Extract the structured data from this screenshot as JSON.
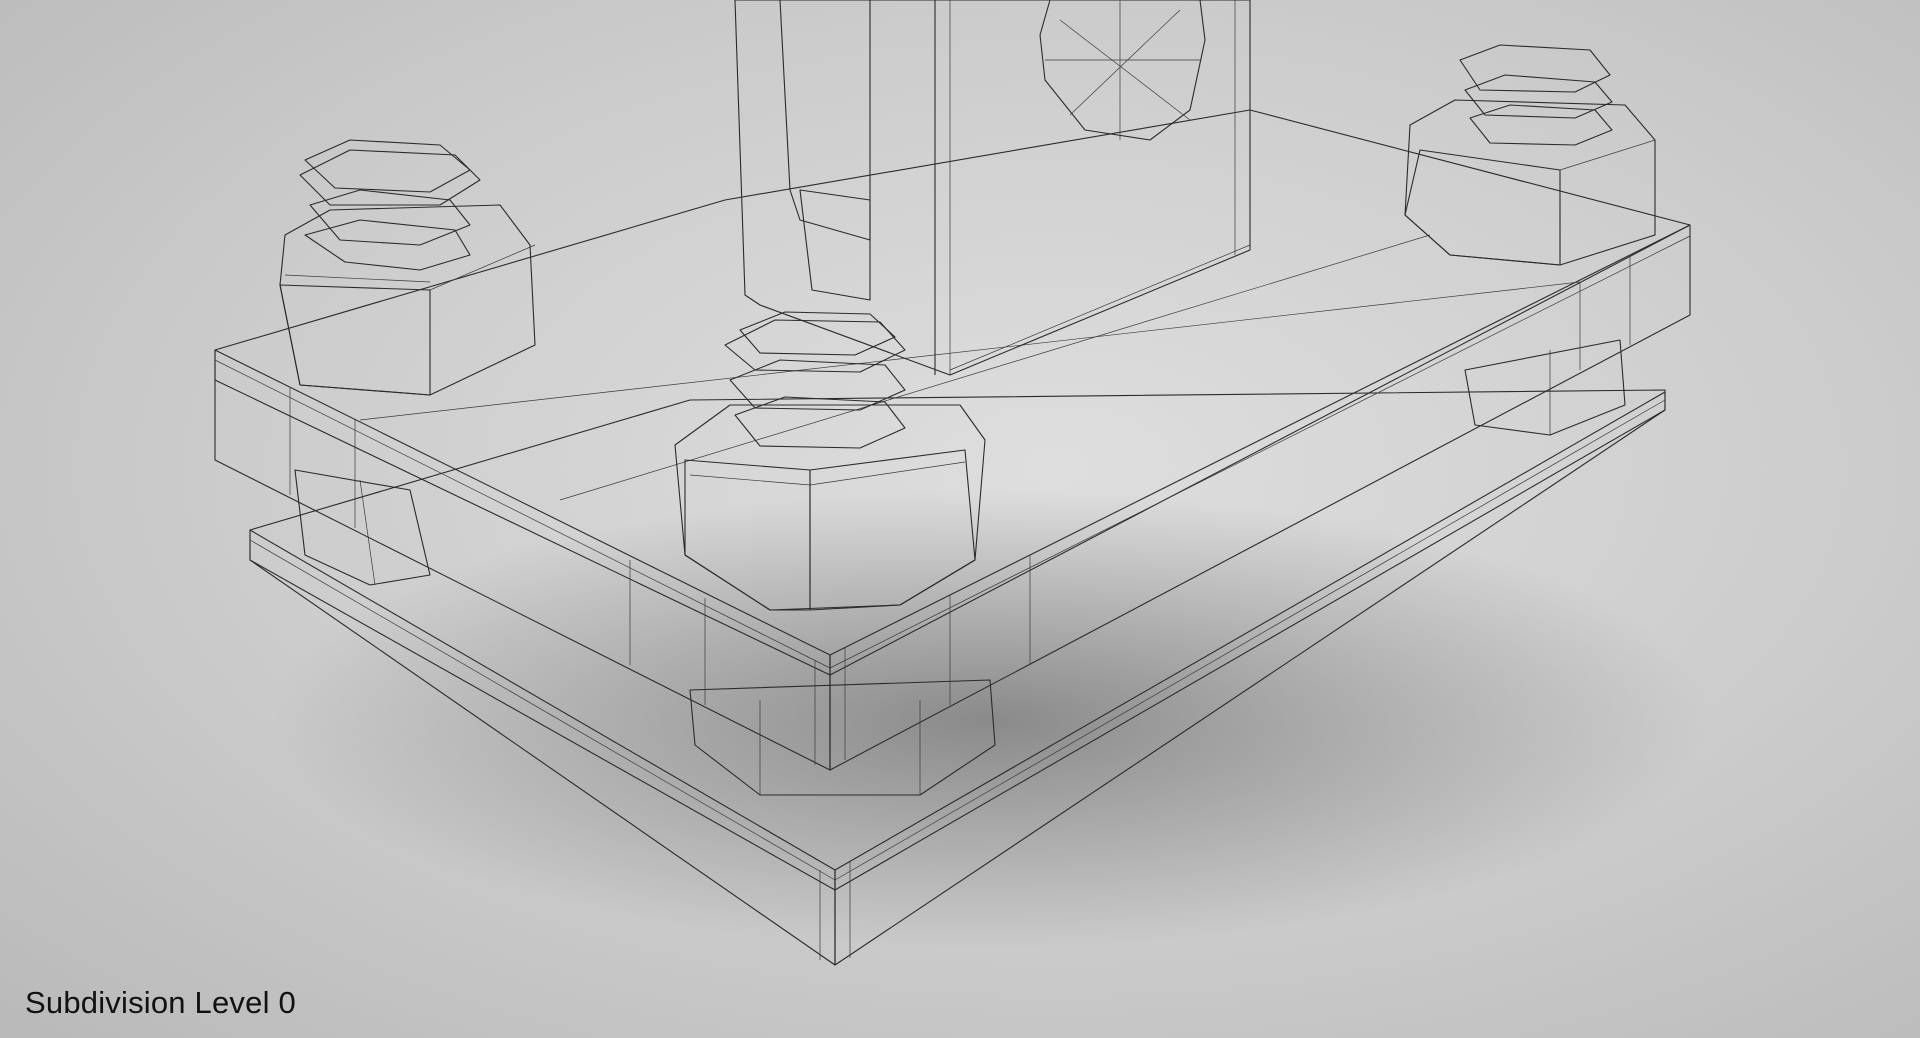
{
  "caption": {
    "label": "Subdivision Level 0"
  },
  "colors": {
    "background": "#cfcfcf",
    "wireframe": "#2b2b2b",
    "face_light": "#a9a9a9",
    "face_mid": "#8e8e8e",
    "face_dark": "#6f6f6f"
  }
}
